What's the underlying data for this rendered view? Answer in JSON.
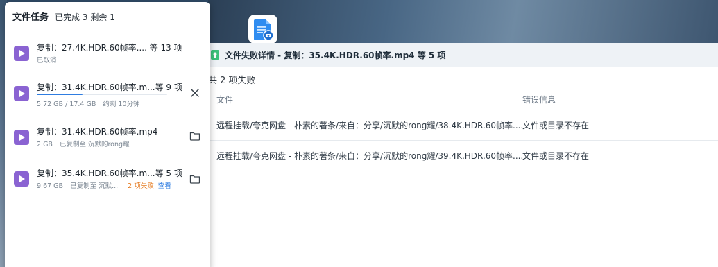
{
  "colors": {
    "accent": "#2f7de1",
    "warning": "#e57a1f",
    "file_icon": "#8a63d2"
  },
  "desktop_app": {
    "icon": "file-station-icon"
  },
  "task_panel": {
    "title": "文件任务",
    "status": "已完成 3 剩余 1",
    "tasks": [
      {
        "name": "复制：27.4K.HDR.60帧率.... 等 13 项",
        "meta": "已取消",
        "icon": "video-file-icon"
      },
      {
        "name": "复制：31.4K.HDR.60帧率.m...等 9 项",
        "size": "5.72 GB / 17.4 GB",
        "remaining": "约剩 10分钟",
        "progress": 0.35,
        "action_icon": "close-icon",
        "icon": "video-file-icon"
      },
      {
        "name": "复制：31.4K.HDR.60帧率.mp4",
        "size": "2 GB",
        "dest": "已复制至 沉默的rong耀",
        "action_icon": "folder-icon",
        "icon": "video-file-icon"
      },
      {
        "name": "复制：35.4K.HDR.60帧率.m...等 5 项",
        "size": "9.67 GB",
        "dest": "已复制至 沉默...",
        "failed": "2 项失败",
        "view": "查看",
        "action_icon": "folder-icon",
        "icon": "video-file-icon"
      }
    ]
  },
  "detail": {
    "title": "文件失败详情 - 复制：35.4K.HDR.60帧率.mp4 等 5 项",
    "summary": "共 2 项失败",
    "columns": {
      "file": "文件",
      "error": "错误信息"
    },
    "rows": [
      {
        "file": "远程挂载/夸克网盘 - 朴素的著条/来自：分享/沉默的rong耀/38.4K.HDR.60帧率....",
        "error": "文件或目录不存在"
      },
      {
        "file": "远程挂载/夸克网盘 - 朴素的著条/来自：分享/沉默的rong耀/39.4K.HDR.60帧率....",
        "error": "文件或目录不存在"
      }
    ]
  }
}
